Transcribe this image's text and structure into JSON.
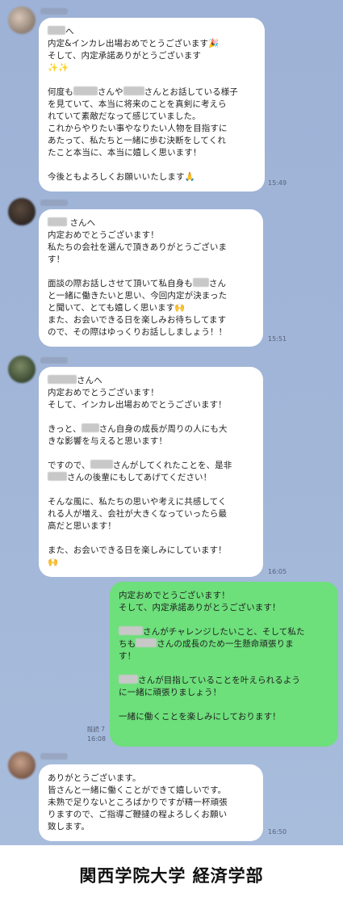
{
  "messages": [
    {
      "time": "15:49",
      "lines": [
        [
          "mask",
          "へ"
        ],
        "内定&インカレ出場おめでとうございます🎉",
        "そして、内定承諾ありがとうございます",
        "✨✨",
        "",
        [
          "何度も",
          "mask",
          "さんや",
          "mask",
          "さんとお話している様子"
        ],
        "を見ていて、本当に将来のことを真剣に考えら",
        "れていて素敵だなって感じていました。",
        "これからやりたい事やなりたい人物を目指すに",
        "あたって、私たちと一緒に歩む決断をしてくれ",
        "たこと本当に、本当に嬉しく思います！",
        "",
        "今後ともよろしくお願いいたします🙏"
      ]
    },
    {
      "time": "15:51",
      "lines": [
        [
          "mask",
          " さんへ"
        ],
        "内定おめでとうございます！",
        "私たちの会社を選んで頂きありがとうございま",
        "す！",
        "",
        [
          "面談の際お話しさせて頂いて私自身も",
          "mask",
          "さん"
        ],
        "と一緒に働きたいと思い、今回内定が決まった",
        "と聞いて、とても嬉しく思います🙌",
        "また、お会いできる日を楽しみお待ちしてます",
        "ので、その際はゆっくりお話ししましょう！！"
      ]
    },
    {
      "time": "16:05",
      "lines": [
        [
          "mask",
          "さんへ"
        ],
        "内定おめでとうございます！",
        "そして、インカレ出場おめでとうございます！",
        "",
        [
          "きっと、",
          "mask",
          "さん自身の成長が周りの人にも大"
        ],
        "きな影響を与えると思います！",
        "",
        [
          "ですので、",
          "mask",
          "さんがしてくれたことを、是非"
        ],
        [
          "mask",
          "さんの後輩にもしてあげてください！"
        ],
        "",
        "そんな風に、私たちの思いや考えに共感してく",
        "れる人が増え、会社が大きくなっていったら最",
        "高だと思います！",
        "",
        "また、お会いできる日を楽しみにしています！",
        "🙌"
      ]
    },
    {
      "time": "16:08",
      "read": "既読 7",
      "lines": [
        "内定おめでとうございます！",
        "そして、内定承諾ありがとうございます！",
        "",
        [
          "mask",
          "さんがチャレンジしたいこと、そして私た"
        ],
        [
          "ちも",
          "mask",
          "さんの成長のため一生懸命頑張りま"
        ],
        "す！",
        "",
        [
          "mask",
          "さんが目指していることを叶えられるよう"
        ],
        "に一緒に頑張りましょう！",
        "",
        "一緒に働くことを楽しみにしております！"
      ]
    },
    {
      "time": "16:50",
      "lines": [
        "ありがとうございます。",
        "皆さんと一緒に働くことができて嬉しいです。",
        "未熟で足りないところばかりですが精一杯頑張",
        "りますので、ご指導ご鞭撻の程よろしくお願い",
        "致します。"
      ]
    }
  ],
  "footer": {
    "caption": "関西学院大学 経済学部"
  },
  "colors": {
    "chat_background": "#a2b6d8",
    "incoming_bubble": "#ffffff",
    "outgoing_bubble": "#6ddf7b"
  }
}
